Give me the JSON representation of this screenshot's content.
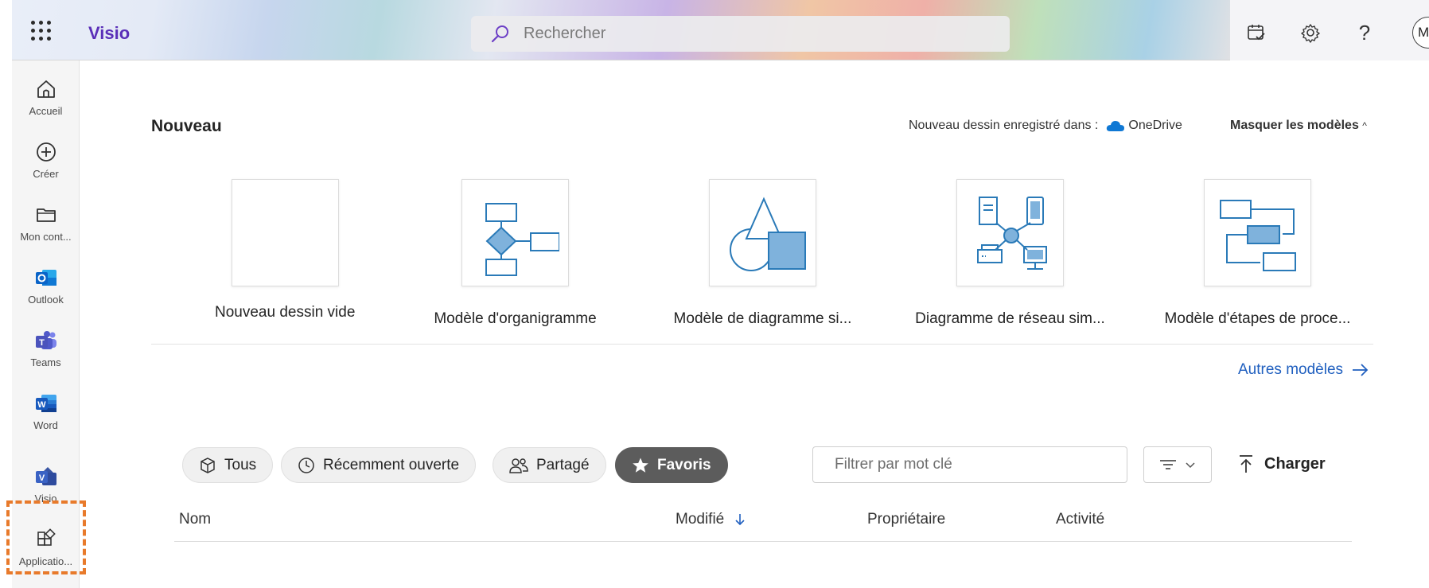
{
  "header": {
    "app_name": "Visio",
    "search_placeholder": "Rechercher",
    "avatar_initials": "MA",
    "icons": [
      "waffle-icon",
      "search-icon",
      "calendar-check-icon",
      "gear-icon",
      "help-icon"
    ]
  },
  "sidebar": {
    "items": [
      {
        "label": "Accueil",
        "icon": "home-icon"
      },
      {
        "label": "Créer",
        "icon": "plus-circle-icon"
      },
      {
        "label": "Mon cont...",
        "icon": "folder-icon"
      },
      {
        "label": "Outlook",
        "icon": "outlook-icon"
      },
      {
        "label": "Teams",
        "icon": "teams-icon"
      },
      {
        "label": "Word",
        "icon": "word-icon"
      },
      {
        "label": "Visio",
        "icon": "visio-icon"
      },
      {
        "label": "Applicatio...",
        "icon": "apps-icon"
      }
    ],
    "highlight_color": "#e87a2b"
  },
  "new_section": {
    "title": "Nouveau",
    "saved_in_label": "Nouveau dessin enregistré dans :",
    "saved_in_location": "OneDrive",
    "hide_templates_label": "Masquer les modèles",
    "templates": [
      {
        "name": "Nouveau dessin vide"
      },
      {
        "name": "Modèle d'organigramme"
      },
      {
        "name": "Modèle de diagramme si..."
      },
      {
        "name": "Diagramme de réseau sim..."
      },
      {
        "name": "Modèle d'étapes de proce..."
      }
    ],
    "more_templates_label": "Autres modèles"
  },
  "files": {
    "filters": [
      {
        "label": "Tous",
        "active": false
      },
      {
        "label": "Récemment ouverte",
        "active": false
      },
      {
        "label": "Partagé",
        "active": false
      },
      {
        "label": "Favoris",
        "active": true
      }
    ],
    "filter_placeholder": "Filtrer par mot clé",
    "upload_label": "Charger",
    "columns": [
      "Nom",
      "Modifié",
      "Propriétaire",
      "Activité"
    ]
  },
  "colors": {
    "brand": "#5a2fb8",
    "accent_blue": "#1f5fbf",
    "diagram_blue": "#2a7ab8",
    "diagram_fill": "#7fb2dc"
  }
}
